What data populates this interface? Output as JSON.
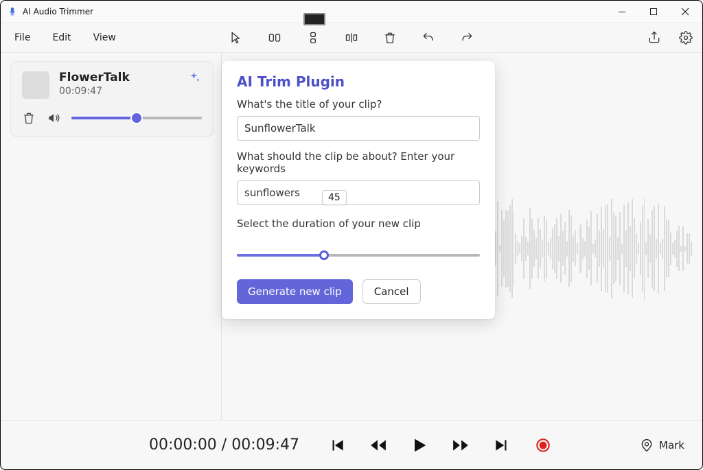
{
  "window": {
    "title": "AI Audio Trimmer"
  },
  "menu": {
    "items": [
      "File",
      "Edit",
      "View"
    ]
  },
  "clip": {
    "title": "FlowerTalk",
    "duration": "00:09:47",
    "volume_percent": 50
  },
  "panel": {
    "heading": "AI Trim Plugin",
    "title_label": "What's the title of your clip?",
    "title_value": "SunflowerTalk",
    "keywords_label": "What should the clip be about? Enter your keywords",
    "keywords_value": "sunflowers",
    "duration_label": "Select the duration of your new clip",
    "duration_value": "45",
    "duration_percent": 36,
    "generate_label": "Generate new clip",
    "cancel_label": "Cancel"
  },
  "transport": {
    "current": "00:00:00",
    "sep": " / ",
    "total": "00:09:47",
    "mark_label": "Mark"
  }
}
